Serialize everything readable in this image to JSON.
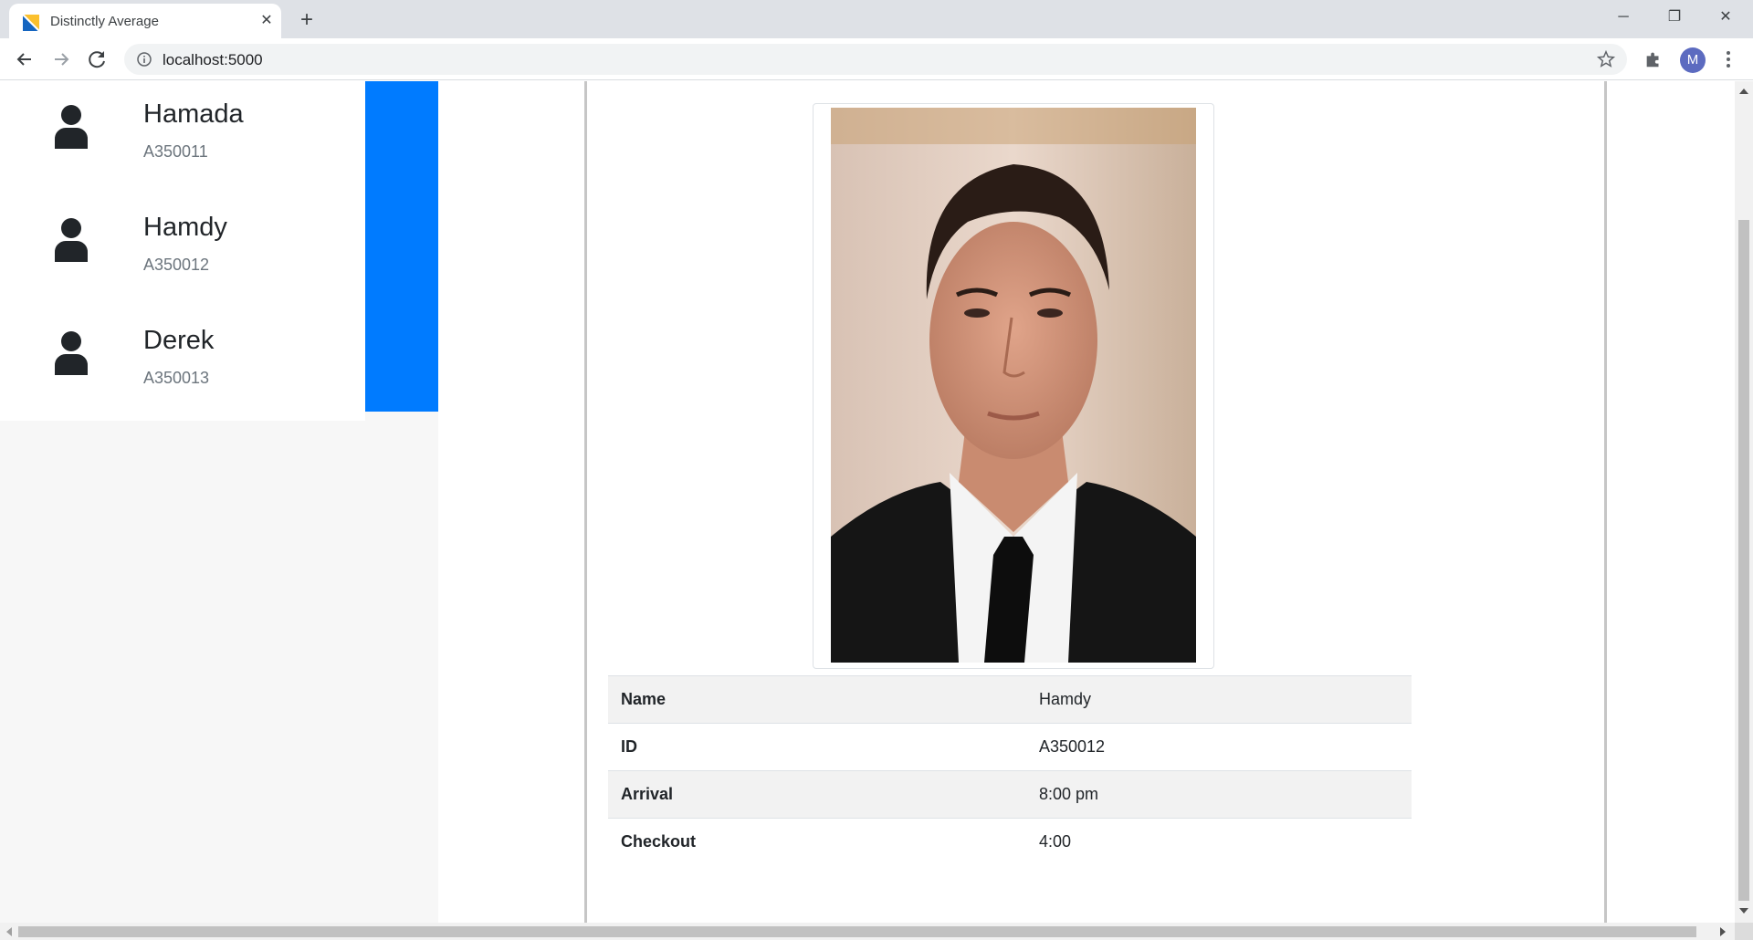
{
  "browser": {
    "tab_title": "Distinctly Average",
    "url": "localhost:5000",
    "profile_initial": "M"
  },
  "users": [
    {
      "name": "Hamada",
      "id": "A350011"
    },
    {
      "name": "Hamdy",
      "id": "A350012"
    },
    {
      "name": "Derek",
      "id": "A350013"
    }
  ],
  "details": {
    "rows": [
      {
        "label": "Name",
        "value": "Hamdy"
      },
      {
        "label": "ID",
        "value": "A350012"
      },
      {
        "label": "Arrival",
        "value": "8:00 pm"
      },
      {
        "label": "Checkout",
        "value": "4:00"
      }
    ]
  },
  "colors": {
    "accent": "#007bff",
    "sidebar_bg": "#f7f7f7",
    "text": "#212529",
    "muted": "#6c757d"
  },
  "icons": [
    "user-icon",
    "lock-info-icon",
    "star-icon",
    "puzzle-icon",
    "back-arrow-icon",
    "forward-arrow-icon",
    "reload-icon",
    "close-icon",
    "plus-icon",
    "minimize-icon",
    "restore-icon",
    "more-vert-icon"
  ]
}
